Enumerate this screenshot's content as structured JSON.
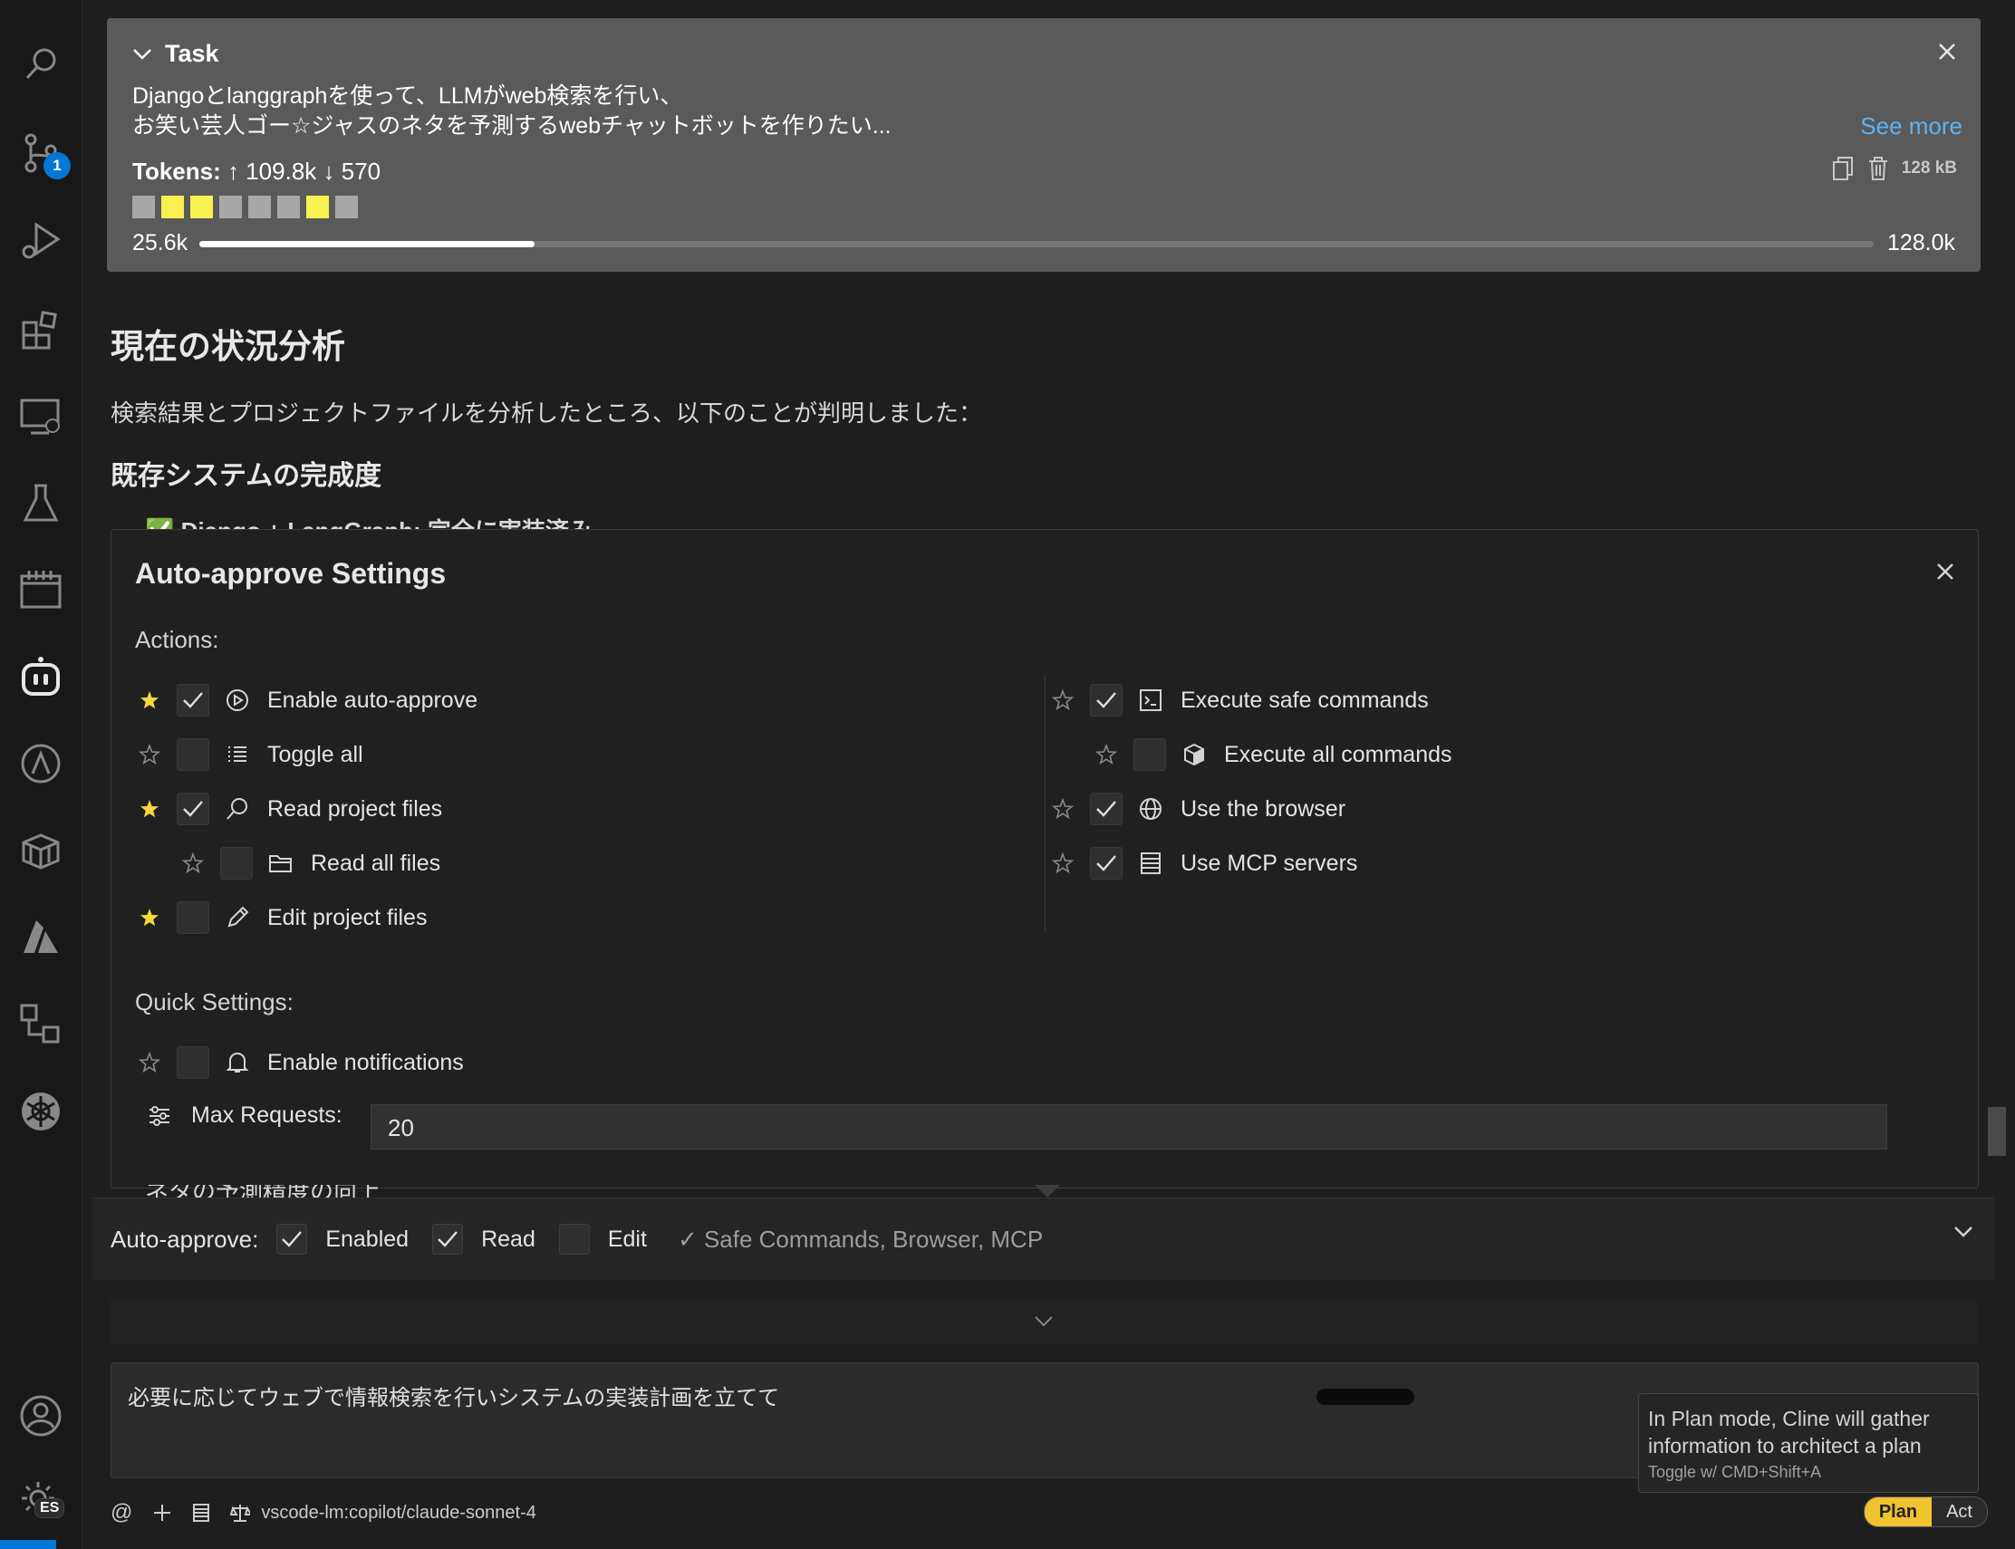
{
  "activity_bar": {
    "source_control_badge": "1",
    "settings_badge": "ES"
  },
  "task": {
    "title": "Task",
    "text_line1": "Djangoとlanggraphを使って、LLMがweb検索を行い、",
    "text_line2": "お笑い芸人ゴー☆ジャスのネタを予測するwebチャットボットを作りたい...",
    "see_more": "See more",
    "tokens_label": "Tokens:",
    "tokens_value": "↑ 109.8k ↓ 570",
    "size": "128 kB",
    "context_used": "25.6k",
    "context_max": "128.0k",
    "context_fraction": 0.2,
    "swatch_colors": [
      "#a8a8a8",
      "#f7f250",
      "#f7f250",
      "#a8a8a8",
      "#a8a8a8",
      "#a8a8a8",
      "#f7f250",
      "#a8a8a8"
    ]
  },
  "chat": {
    "heading": "現在の状況分析",
    "paragraph": "検索結果とプロジェクトファイルを分析したところ、以下のことが判明しました：",
    "subheading": "既存システムの完成度",
    "cut_line_top": "✅ Django + LangGraph: 完全に実装済み",
    "cut_line_bottom": "ネタの予測精度の向上"
  },
  "auto_approve_settings": {
    "title": "Auto-approve Settings",
    "actions_label": "Actions:",
    "left_actions": [
      {
        "label": "Enable auto-approve",
        "starred": true,
        "checked": true,
        "icon": "play-circle-icon"
      },
      {
        "label": "Toggle all",
        "starred": false,
        "checked": false,
        "icon": "list-icon"
      },
      {
        "label": "Read project files",
        "starred": true,
        "checked": true,
        "icon": "search-icon"
      },
      {
        "label": "Read all files",
        "starred": false,
        "checked": false,
        "icon": "folder-icon"
      },
      {
        "label": "Edit project files",
        "starred": true,
        "checked": false,
        "icon": "pencil-icon"
      }
    ],
    "right_actions": [
      {
        "label": "Execute safe commands",
        "starred": false,
        "checked": true,
        "icon": "terminal-icon"
      },
      {
        "label": "Execute all commands",
        "starred": false,
        "checked": false,
        "icon": "cube-icon"
      },
      {
        "label": "Use the browser",
        "starred": false,
        "checked": true,
        "icon": "globe-icon"
      },
      {
        "label": "Use MCP servers",
        "starred": false,
        "checked": true,
        "icon": "server-icon"
      }
    ],
    "quick_settings_label": "Quick Settings:",
    "notifications_label": "Enable notifications",
    "max_requests_label": "Max Requests:",
    "max_requests_value": "20"
  },
  "auto_approve_bar": {
    "label": "Auto-approve:",
    "items": [
      {
        "label": "Enabled",
        "checked": true
      },
      {
        "label": "Read",
        "checked": true
      },
      {
        "label": "Edit",
        "checked": false
      }
    ],
    "summary": "✓ Safe Commands, Browser, MCP"
  },
  "input": {
    "text": "必要に応じてウェブで情報検索を行いシステムの実装計画を立てて"
  },
  "tooltip": {
    "text": "In Plan mode, Cline will gather information to architect a plan",
    "shortcut": "Toggle w/ CMD+Shift+A"
  },
  "toolbar": {
    "model": "vscode-lm:copilot/claude-sonnet-4",
    "plan": "Plan",
    "act": "Act"
  },
  "colors": {
    "star_active": "#f5d93b",
    "accent": "#0078d4",
    "plan_mode": "#f0c330"
  }
}
